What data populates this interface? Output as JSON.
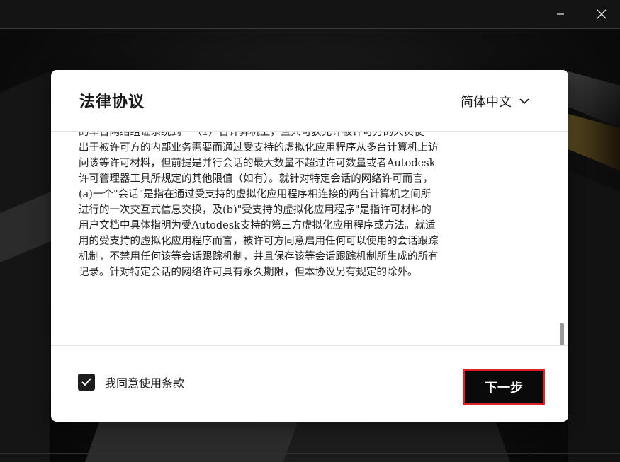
{
  "window": {
    "minimize_icon": "minimize-icon",
    "close_icon": "close-icon"
  },
  "dialog": {
    "title": "法律协议",
    "language": {
      "selected": "简体中文",
      "icon": "chevron-down-icon"
    },
    "legal_text": "的单台网络组证系统到一（1）台计算机上，且只可获允许被许可方的大员使\n出于被许可方的内部业务需要而通过受支持的虚拟化应用程序从多台计算机上访\n问该等许可材料，但前提是并行会话的最大数量不超过许可数量或者Autodesk\n许可管理器工具所规定的其他限值（如有）。就针对特定会话的网络许可而言，\n(a)一个\"会话\"是指在通过受支持的虚拟化应用程序相连接的两台计算机之间所\n进行的一次交互式信息交换，及(b)\"受支持的虚拟化应用程序\"是指许可材料的\n用户文档中具体指明为受Autodesk支持的第三方虚拟化应用程序或方法。就适\n用的受支持的虚拟化应用程序而言，被许可方同意启用任何可以使用的会话跟踪\n机制，不禁用任何该等会话跟踪机制，并且保存该等会话跟踪机制所生成的所有\n记录。针对特定会话的网络许可具有永久期限，但本协议另有规定的除外。",
    "agree": {
      "checked": true,
      "prefix": "我同意",
      "link": "使用条款"
    },
    "next_button": "下一步"
  },
  "colors": {
    "accent_border": "#e0202b",
    "button_bg": "#0a0a0a"
  }
}
